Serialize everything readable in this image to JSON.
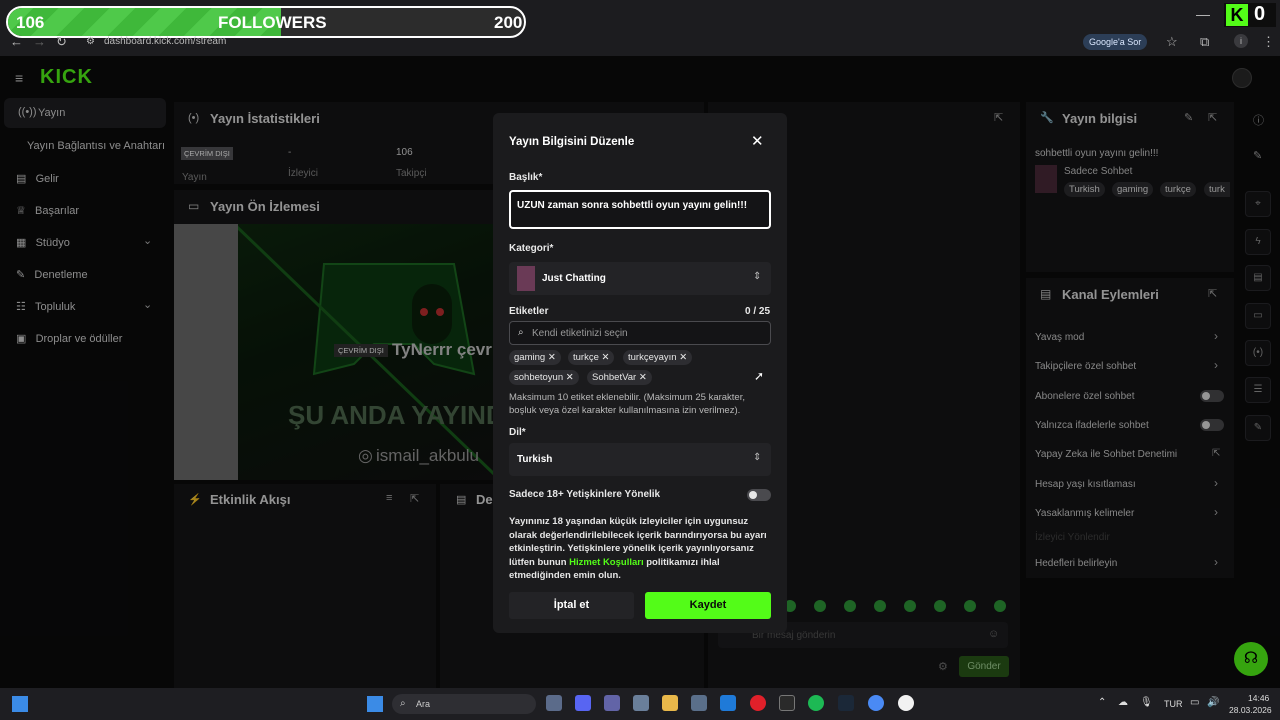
{
  "overlay": {
    "left_value": "106",
    "label": "FOLLOWERS",
    "right_value": "200",
    "progress": 0.53,
    "kick_count": "0",
    "kick_letter": "K"
  },
  "browser": {
    "url": "dashboard.kick.com/stream",
    "google_btn": "Google'a Sor"
  },
  "sidebar": {
    "items": [
      {
        "label": "Yayın"
      },
      {
        "label": "Yayın Bağlantısı ve Anahtarı"
      },
      {
        "label": "Gelir"
      },
      {
        "label": "Başarılar"
      },
      {
        "label": "Stüdyo"
      },
      {
        "label": "Denetleme"
      },
      {
        "label": "Topluluk"
      },
      {
        "label": "Droplar ve ödüller"
      }
    ]
  },
  "stats": {
    "title": "Yayın İstatistikleri",
    "status_badge": "ÇEVRİM DIŞI",
    "status_label": "Yayın",
    "viewers_value": "-",
    "viewers_label": "İzleyici",
    "followers_value": "106",
    "followers_label": "Takipçi"
  },
  "preview": {
    "title": "Yayın Ön İzlemesi",
    "offline_badge": "ÇEVRİM DIŞI",
    "channel": "TyNerrr çevr",
    "banner_text": "ŞU ANDA YAYINDA",
    "insta": "ismail_akbulu"
  },
  "activity": {
    "title": "Etkinlik Akışı",
    "second_title": "De"
  },
  "modal": {
    "title": "Yayın Bilgisini Düzenle",
    "title_label": "Başlık*",
    "title_value": "UZUN zaman sonra sohbettli oyun yayını gelin!!!",
    "category_label": "Kategori*",
    "category_value": "Just Chatting",
    "tags_label": "Etiketler",
    "tags_count": "0 / 25",
    "tags_placeholder": "Kendi etiketinizi seçin",
    "tags": [
      "gaming",
      "turkçe",
      "turkçeyayın",
      "sohbetoyun",
      "SohbetVar"
    ],
    "tags_hint": "Maksimum 10 etiket eklenebilir. (Maksimum 25 karakter, boşluk veya özel karakter kullanılmasına izin verilmez).",
    "lang_label": "Dil*",
    "lang_value": "Turkish",
    "adult_label": "Sadece 18+ Yetişkinlere Yönelik",
    "adult_text_1": "Yayınınız 18 yaşından küçük izleyiciler için uygunsuz olarak değerlendirilebilecek içerik barındırıyorsa bu ayarı etkinleştirin. Yetişkinlere yönelik içerik yayınlıyorsanız lütfen bunun ",
    "adult_link": "Hizmet Koşulları",
    "adult_text_2": " politikamızı ihlal etmediğinden emin olun.",
    "cancel": "İptal et",
    "save": "Kaydet",
    "accent": "#53fc18"
  },
  "info": {
    "title": "Yayın bilgisi",
    "stream_title": "sohbettli oyun yayını gelin!!!",
    "category": "Sadece Sohbet",
    "tags": [
      "Turkish",
      "gaming",
      "turkçe",
      "turk"
    ]
  },
  "actions": {
    "title": "Kanal Eylemleri",
    "items": [
      {
        "label": "Yavaş mod"
      },
      {
        "label": "Takipçilere özel sohbet"
      },
      {
        "label": "Abonelere özel sohbet"
      },
      {
        "label": "Yalnızca ifadelerle sohbet"
      },
      {
        "label": "Yapay Zeka ile Sohbet Denetimi"
      },
      {
        "label": "Hesap yaşı kısıtlaması"
      },
      {
        "label": "Yasaklanmış kelimeler"
      },
      {
        "label": "İzleyici Yönlendir"
      },
      {
        "label": "Hedefleri belirleyin"
      }
    ]
  },
  "chat": {
    "placeholder": "Bir mesaj gönderin",
    "send": "Gönder"
  },
  "taskbar": {
    "search": "Ara",
    "lang": "TUR",
    "time": "14:46",
    "date": "28.03.2026"
  }
}
